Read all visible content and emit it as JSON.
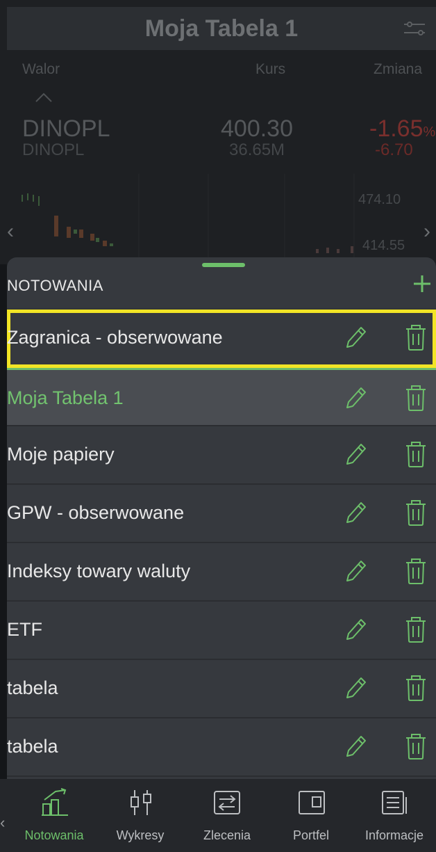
{
  "background": {
    "title": "Moja Tabela 1",
    "headers": {
      "walor": "Walor",
      "kurs": "Kurs",
      "zmiana": "Zmiana"
    },
    "row": {
      "symbol": "DINOPL",
      "subsymbol": "DINOPL",
      "price": "400.30",
      "volume": "36.65M",
      "change_pct": "-1.65",
      "pct_sign": "%",
      "change_abs": "-6.70"
    },
    "chart": {
      "high_label": "474.10",
      "low_label": "414.55"
    }
  },
  "sheet": {
    "title": "NOTOWANIA",
    "items": [
      {
        "label": "Zagranica - obserwowane",
        "highlighted": true
      },
      {
        "label": "Moja Tabela 1",
        "active": true
      },
      {
        "label": "Moje papiery"
      },
      {
        "label": "GPW - obserwowane"
      },
      {
        "label": "Indeksy towary waluty"
      },
      {
        "label": "ETF"
      },
      {
        "label": "tabela"
      },
      {
        "label": "tabela"
      }
    ]
  },
  "nav": {
    "items": [
      {
        "label": "Notowania",
        "icon": "chart-growth-icon",
        "active": true
      },
      {
        "label": "Wykresy",
        "icon": "candlestick-icon"
      },
      {
        "label": "Zlecenia",
        "icon": "exchange-icon"
      },
      {
        "label": "Portfel",
        "icon": "wallet-icon"
      },
      {
        "label": "Informacje",
        "icon": "news-icon"
      }
    ]
  },
  "colors": {
    "accent": "#6dbf6a",
    "highlight": "#f2e526",
    "negative": "#c9443f",
    "sheet_bg": "#36393e"
  }
}
